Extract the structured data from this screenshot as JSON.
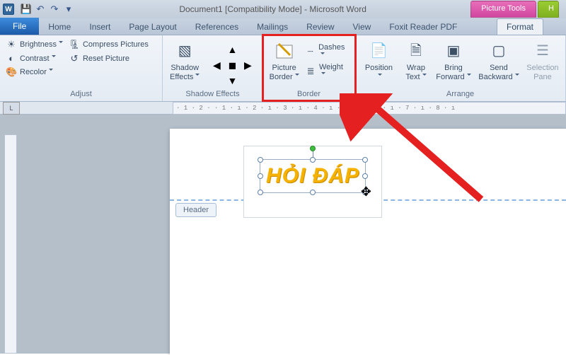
{
  "title": "Document1 [Compatibility Mode] - Microsoft Word",
  "tool_context": {
    "label": "Picture Tools",
    "tab": "Format"
  },
  "qat": {
    "save": "💾",
    "undo": "↶",
    "redo": "↷",
    "custom": "▾"
  },
  "tabs": {
    "file": "File",
    "items": [
      "Home",
      "Insert",
      "Page Layout",
      "References",
      "Mailings",
      "Review",
      "View",
      "Foxit Reader PDF"
    ],
    "active": "Format"
  },
  "ribbon": {
    "adjust": {
      "label": "Adjust",
      "brightness": "Brightness",
      "contrast": "Contrast",
      "recolor": "Recolor",
      "compress": "Compress Pictures",
      "reset": "Reset Picture"
    },
    "shadow_effects": {
      "label": "Shadow Effects",
      "button": "Shadow\nEffects"
    },
    "border": {
      "label": "Border",
      "picture_border": "Picture\nBorder",
      "dashes": "Dashes",
      "weight": "Weight"
    },
    "arrange": {
      "label": "Arrange",
      "position": "Position",
      "wrap": "Wrap\nText",
      "bring": "Bring\nForward",
      "send": "Send\nBackward",
      "selection": "Selection\nPane"
    }
  },
  "ruler": "· 1 · 2 ·    · 1 · ı · 2 · ı · 3 · ı · 4 · ı · 5 · ı · 6 · ı · 7 · ı · 8 · ı",
  "page": {
    "header_label": "Header",
    "image_text": "HỎI ĐÁP"
  }
}
